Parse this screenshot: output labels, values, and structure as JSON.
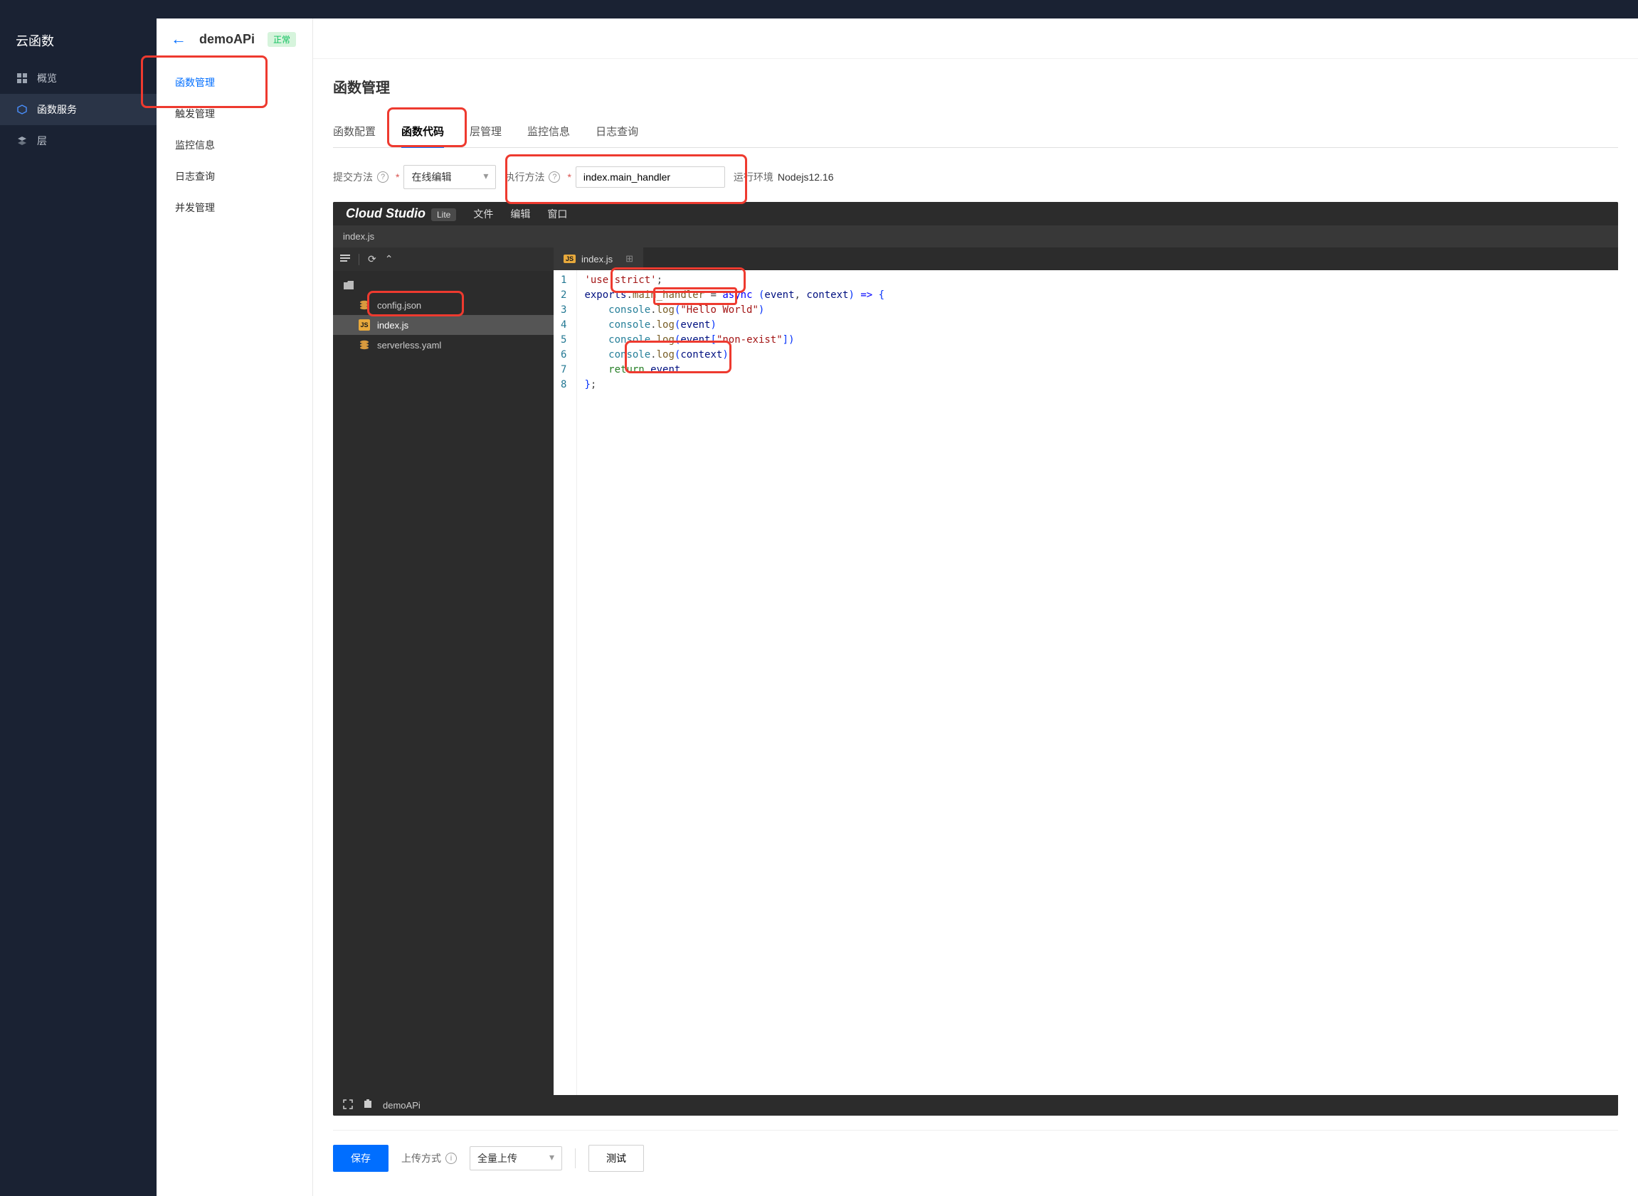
{
  "app": {
    "product_title": "云函数"
  },
  "left_nav": {
    "items": [
      {
        "label": "概览",
        "id": "overview",
        "icon": "grid"
      },
      {
        "label": "函数服务",
        "id": "functions",
        "icon": "cube",
        "active": true
      },
      {
        "label": "层",
        "id": "layers",
        "icon": "layers"
      }
    ]
  },
  "header": {
    "title": "demoAPi",
    "status_text": "正常"
  },
  "sub_nav": {
    "items": [
      {
        "label": "函数管理",
        "id": "fn-manage",
        "active": true
      },
      {
        "label": "触发管理",
        "id": "trigger-manage"
      },
      {
        "label": "监控信息",
        "id": "monitor"
      },
      {
        "label": "日志查询",
        "id": "logs"
      },
      {
        "label": "并发管理",
        "id": "concurrency"
      }
    ]
  },
  "panel": {
    "title": "函数管理"
  },
  "tabs": {
    "items": [
      {
        "label": "函数配置",
        "id": "config"
      },
      {
        "label": "函数代码",
        "id": "code",
        "active": true
      },
      {
        "label": "层管理",
        "id": "layer-mgmt"
      },
      {
        "label": "监控信息",
        "id": "monitor-tab"
      },
      {
        "label": "日志查询",
        "id": "log-tab"
      }
    ]
  },
  "form": {
    "submit_method_label": "提交方法",
    "submit_method_value": "在线编辑",
    "exec_method_label": "执行方法",
    "exec_method_value": "index.main_handler",
    "runtime_label": "运行环境",
    "runtime_value": "Nodejs12.16"
  },
  "editor": {
    "brand": "Cloud Studio",
    "brand_badge": "Lite",
    "menu": {
      "file": "文件",
      "edit": "编辑",
      "window": "窗口"
    },
    "open_file_tab": "index.js",
    "code_tab_label": "index.js",
    "files": {
      "root_opener": "",
      "items": [
        {
          "name": "config.json",
          "type": "json"
        },
        {
          "name": "index.js",
          "type": "js",
          "selected": true
        },
        {
          "name": "serverless.yaml",
          "type": "yaml"
        }
      ]
    },
    "code": {
      "line_count": 8,
      "raw": "'use strict';\nexports.main_handler = async (event, context) => {\n    console.log(\"Hello World\")\n    console.log(event)\n    console.log(event[\"non-exist\"])\n    console.log(context)\n    return event\n};"
    },
    "statusbar_project": "demoAPi"
  },
  "footer": {
    "save_btn": "保存",
    "upload_mode_label": "上传方式",
    "upload_mode_value": "全量上传",
    "test_btn": "测试"
  }
}
